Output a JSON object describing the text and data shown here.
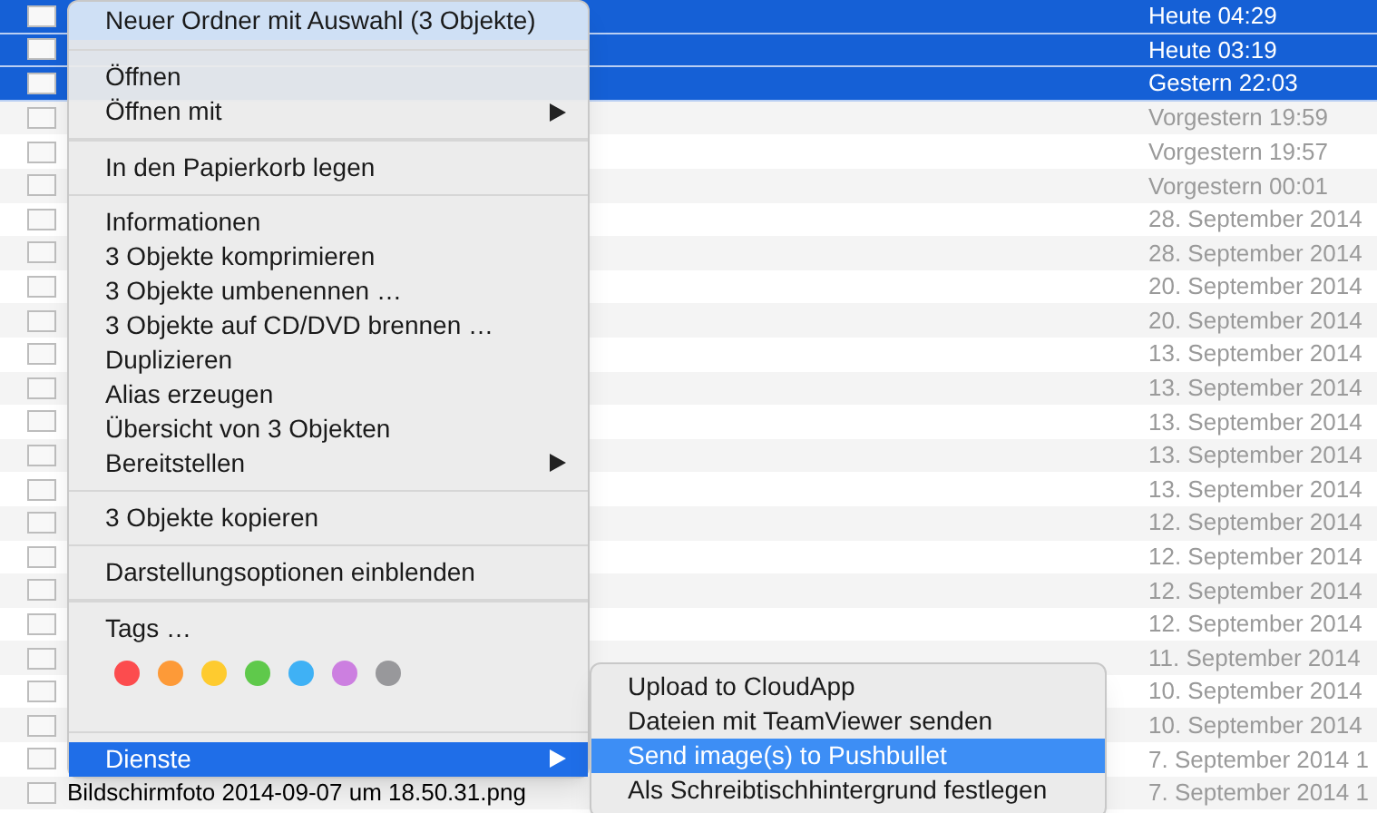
{
  "files": [
    {
      "date": "Heute 04:29",
      "selected": true
    },
    {
      "date": "Heute 03:19",
      "selected": true
    },
    {
      "date": "Gestern 22:03",
      "selected": true
    },
    {
      "date": "Vorgestern 19:59",
      "selected": false
    },
    {
      "date": "Vorgestern 19:57",
      "selected": false
    },
    {
      "date": "Vorgestern 00:01",
      "selected": false
    },
    {
      "date": "28. September 2014",
      "selected": false
    },
    {
      "date": "28. September 2014",
      "selected": false
    },
    {
      "date": "20. September 2014",
      "selected": false
    },
    {
      "date": "20. September 2014",
      "selected": false
    },
    {
      "date": "13. September 2014",
      "selected": false
    },
    {
      "date": "13. September 2014",
      "selected": false
    },
    {
      "date": "13. September 2014",
      "selected": false
    },
    {
      "date": "13. September 2014",
      "selected": false
    },
    {
      "date": "13. September 2014",
      "selected": false
    },
    {
      "date": "12. September 2014",
      "selected": false
    },
    {
      "date": "12. September 2014",
      "selected": false
    },
    {
      "date": "12. September 2014",
      "selected": false
    },
    {
      "date": "12. September 2014",
      "selected": false
    },
    {
      "date": "11. September 2014",
      "selected": false
    },
    {
      "date": "10. September 2014",
      "selected": false
    },
    {
      "date": "10. September 2014",
      "selected": false
    },
    {
      "date": "7. September 2014 1",
      "selected": false
    },
    {
      "name": "Bildschirmfoto 2014-09-07 um 18.50.31.png",
      "date": "7. September 2014 1",
      "selected": false
    }
  ],
  "context_menu": {
    "groups": [
      [
        {
          "label": "Neuer Ordner mit Auswahl (3 Objekte)",
          "submenu": false,
          "selected": false,
          "kind": "header"
        }
      ],
      [
        {
          "label": "Öffnen",
          "submenu": false,
          "selected": false
        },
        {
          "label": "Öffnen mit",
          "submenu": true,
          "selected": false
        }
      ],
      [
        {
          "label": "In den Papierkorb legen",
          "submenu": false,
          "selected": false
        }
      ],
      [
        {
          "label": "Informationen",
          "submenu": false,
          "selected": false
        },
        {
          "label": "3 Objekte komprimieren",
          "submenu": false,
          "selected": false
        },
        {
          "label": "3 Objekte umbenennen …",
          "submenu": false,
          "selected": false
        },
        {
          "label": "3 Objekte auf CD/DVD brennen …",
          "submenu": false,
          "selected": false
        },
        {
          "label": "Duplizieren",
          "submenu": false,
          "selected": false
        },
        {
          "label": "Alias erzeugen",
          "submenu": false,
          "selected": false
        },
        {
          "label": "Übersicht von 3 Objekten",
          "submenu": false,
          "selected": false
        },
        {
          "label": "Bereitstellen",
          "submenu": true,
          "selected": false
        }
      ],
      [
        {
          "label": "3 Objekte kopieren",
          "submenu": false,
          "selected": false
        }
      ],
      [
        {
          "label": "Darstellungsoptionen einblenden",
          "submenu": false,
          "selected": false
        }
      ],
      [
        {
          "label": "Tags …",
          "submenu": false,
          "selected": false,
          "kind": "tags",
          "tags": [
            {
              "color": "#fc4c4e"
            },
            {
              "color": "#fd9a38"
            },
            {
              "color": "#fecb2f"
            },
            {
              "color": "#5fc94b"
            },
            {
              "color": "#3fb1f5"
            },
            {
              "color": "#cc7fe0"
            },
            {
              "color": "#98989b"
            }
          ]
        }
      ],
      [
        {
          "label": "Dienste",
          "submenu": true,
          "selected": true
        }
      ]
    ]
  },
  "services_menu": {
    "items": [
      {
        "label": "Upload to CloudApp",
        "selected": false
      },
      {
        "label": "Dateien mit TeamViewer senden",
        "selected": false
      },
      {
        "label": "Send image(s) to Pushbullet",
        "selected": true
      },
      {
        "label": "Als Schreibtischhintergrund festlegen",
        "selected": false
      }
    ]
  }
}
